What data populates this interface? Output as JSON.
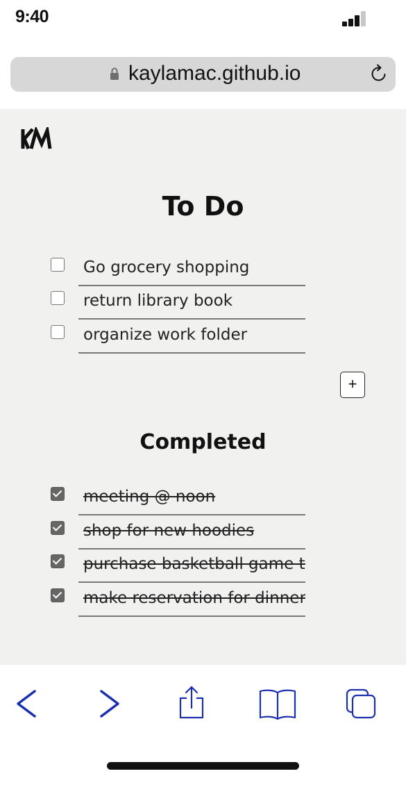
{
  "status_bar": {
    "time": "9:40",
    "signal_icon": "cellular-signal-icon"
  },
  "browser": {
    "url": "kaylamac.github.io",
    "lock_icon": "lock-icon",
    "reload_icon": "reload-icon"
  },
  "page": {
    "logo_icon": "km-logo-icon",
    "todo_title": "To Do",
    "todo_items": [
      {
        "label": "Go grocery shopping",
        "checked": false
      },
      {
        "label": "return library book",
        "checked": false
      },
      {
        "label": "organize work folder",
        "checked": false
      }
    ],
    "add_button_label": "+",
    "completed_title": "Completed",
    "completed_items": [
      {
        "label": "meeting @ noon",
        "checked": true
      },
      {
        "label": "shop for new hoodies",
        "checked": true
      },
      {
        "label": "purchase basketball game tic",
        "checked": true
      },
      {
        "label": "make reservation for dinner",
        "checked": true
      }
    ]
  },
  "toolbar": {
    "icons": [
      "back-icon",
      "forward-icon",
      "share-icon",
      "bookmarks-icon",
      "tabs-icon"
    ],
    "accent_color": "#1a2fb0"
  }
}
